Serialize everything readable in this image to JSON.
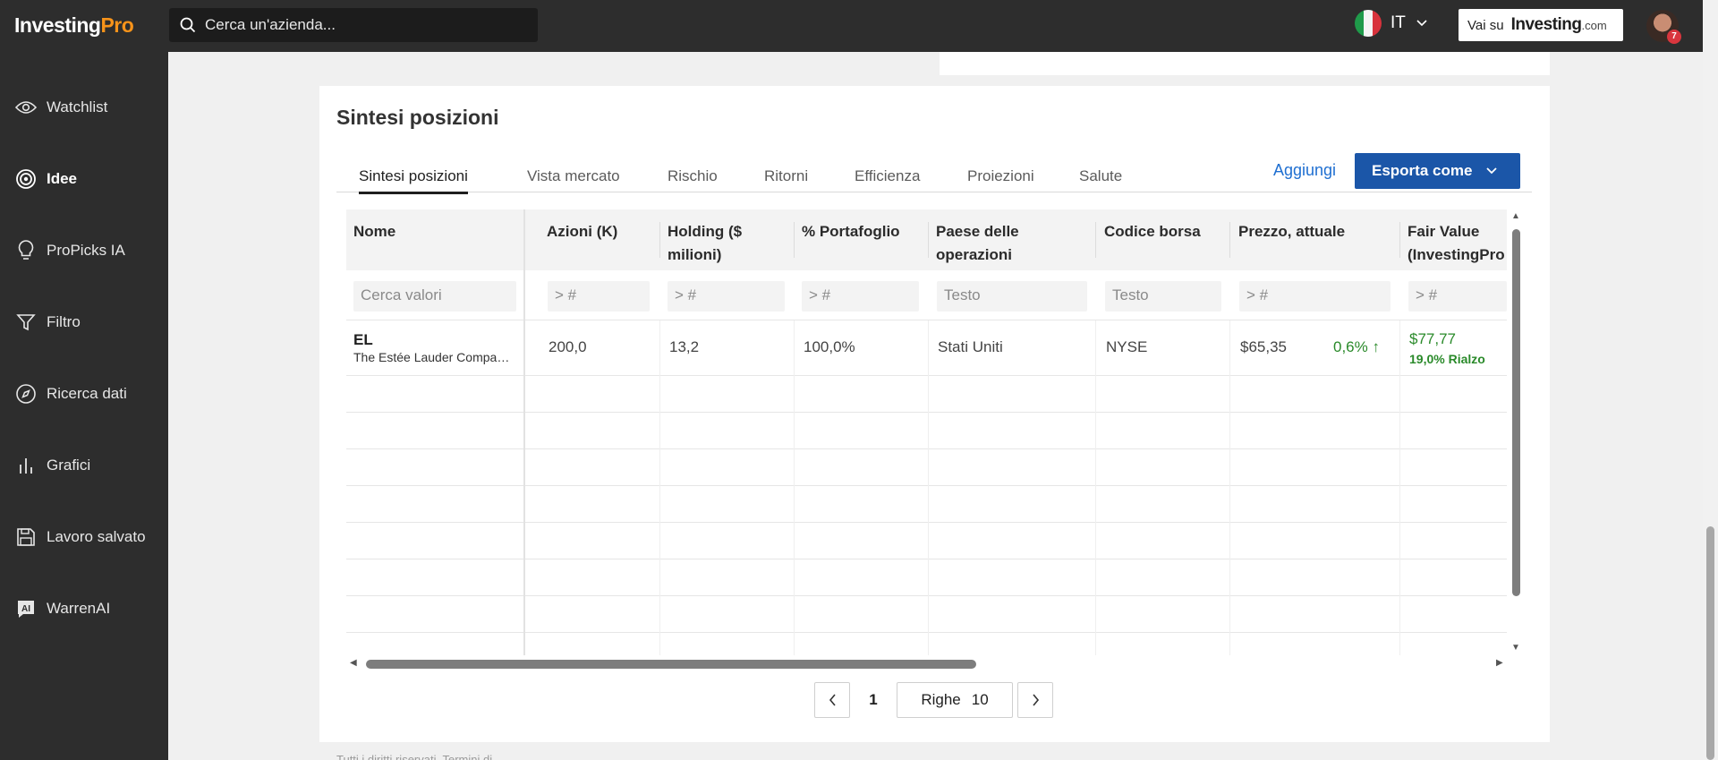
{
  "app": {
    "logo_main": "Investing",
    "logo_pro": "Pro",
    "search_placeholder": "Cerca un'azienda...",
    "language_code": "IT",
    "vai_su_label": "Vai su",
    "vai_brand": "Investing",
    "vai_dotcom": ".com",
    "notification_count": "7"
  },
  "sidebar": {
    "items": [
      {
        "label": "Watchlist",
        "icon": "eye-icon"
      },
      {
        "label": "Idee",
        "icon": "target-icon",
        "active": true
      },
      {
        "label": "ProPicks IA",
        "icon": "lightbulb-icon"
      },
      {
        "label": "Filtro",
        "icon": "filter-icon"
      },
      {
        "label": "Ricerca dati",
        "icon": "compass-icon"
      },
      {
        "label": "Grafici",
        "icon": "bar-chart-icon"
      },
      {
        "label": "Lavoro salvato",
        "icon": "save-icon"
      },
      {
        "label": "WarrenAI",
        "icon": "ai-icon"
      }
    ]
  },
  "card": {
    "title": "Sintesi posizioni",
    "tabs": [
      "Sintesi posizioni",
      "Vista mercato",
      "Rischio",
      "Ritorni",
      "Efficienza",
      "Proiezioni",
      "Salute"
    ],
    "add_label": "Aggiungi",
    "export_label": "Esporta come"
  },
  "table": {
    "columns": [
      {
        "line1": "Nome",
        "line2": ""
      },
      {
        "line1": "Azioni (K)",
        "line2": ""
      },
      {
        "line1": "Holding ($",
        "line2": "milioni)"
      },
      {
        "line1": "% Portafoglio",
        "line2": ""
      },
      {
        "line1": "Paese delle",
        "line2": "operazioni"
      },
      {
        "line1": "Codice borsa",
        "line2": ""
      },
      {
        "line1": "Prezzo, attuale",
        "line2": ""
      },
      {
        "line1": "Fair Value",
        "line2": "(InvestingPro"
      }
    ],
    "filters": [
      "Cerca valori",
      "> #",
      "> #",
      "> #",
      "Testo",
      "Testo",
      "> #",
      "> #"
    ],
    "rows": [
      {
        "ticker": "EL",
        "company": "The Estée Lauder Companies Inc.",
        "shares": "200,0",
        "holding": "13,2",
        "portfolio_pct": "100,0%",
        "country": "Stati Uniti",
        "exchange": "NYSE",
        "price": "$65,35",
        "change": "0,6%",
        "fair_value": "$77,77",
        "upside": "19,0% Rialzo"
      }
    ]
  },
  "pagination": {
    "current_page": "1",
    "rows_label": "Righe",
    "rows_value": "10"
  },
  "footer": {
    "text": "Tutti i diritti riservati. Termini di"
  },
  "colors": {
    "topbar": "#2d2d2d",
    "accent_orange": "#f7931a",
    "export_blue": "#1b56a8",
    "link_blue": "#1f6fd1",
    "positive_green": "#2a8a2a"
  }
}
